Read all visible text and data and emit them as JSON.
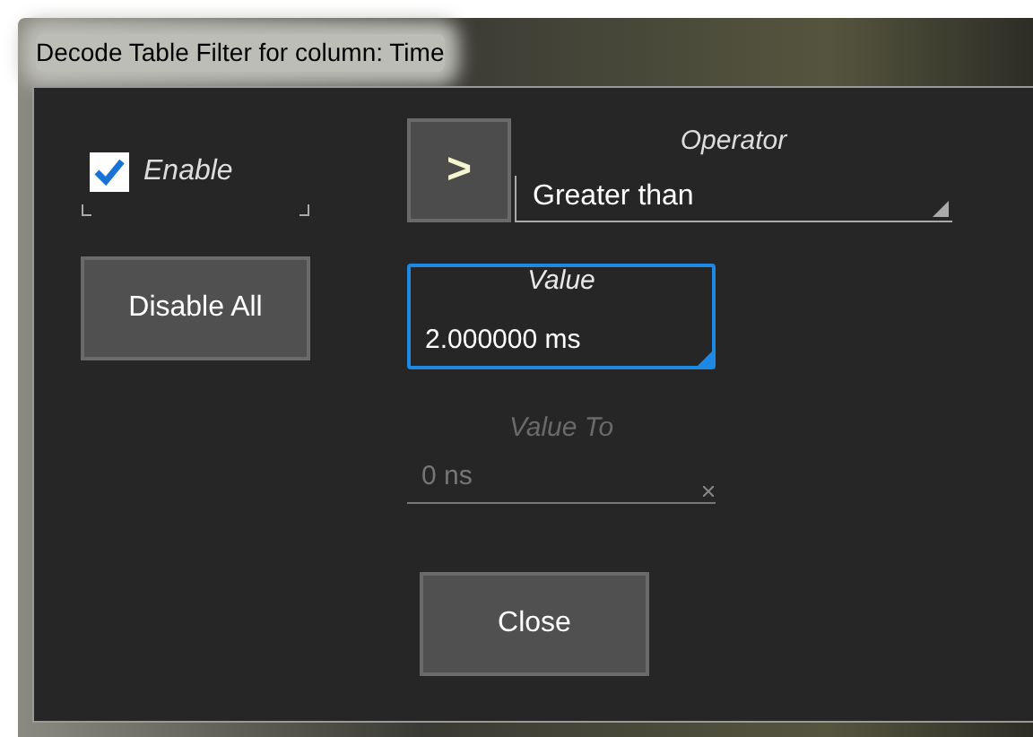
{
  "window": {
    "title": "Decode Table Filter for column: Time"
  },
  "enable": {
    "label": "Enable",
    "checked": true
  },
  "operator_button": {
    "label": ">"
  },
  "operator": {
    "label": "Operator",
    "value": "Greater than"
  },
  "disable_all": {
    "label": "Disable All"
  },
  "value": {
    "label": "Value",
    "value": "2.000000 ms",
    "focused": true,
    "disabled": false
  },
  "value_to": {
    "label": "Value To",
    "value": "0 ns",
    "focused": false,
    "disabled": true
  },
  "buttons": [
    "Close"
  ]
}
